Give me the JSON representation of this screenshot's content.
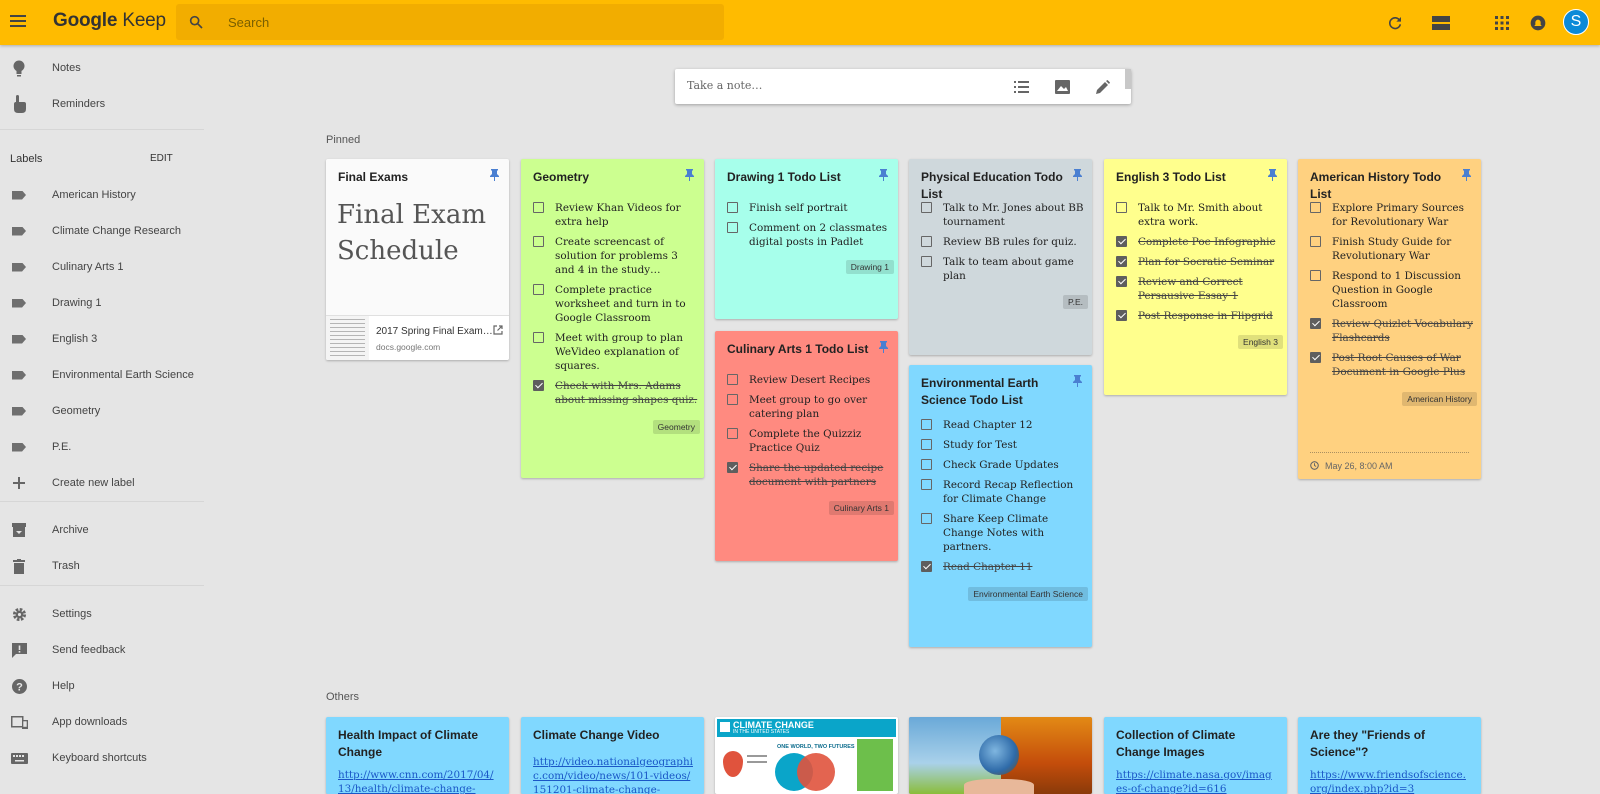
{
  "header": {
    "logo_google": "Google",
    "logo_keep": "Keep",
    "search_placeholder": "Search",
    "avatar_initial": "S"
  },
  "sidebar": {
    "notes": "Notes",
    "reminders": "Reminders",
    "labels_heading": "Labels",
    "labels_edit": "EDIT",
    "labels": [
      "American History",
      "Climate Change Research",
      "Culinary Arts 1",
      "Drawing 1",
      "English 3",
      "Environmental Earth Science",
      "Geometry",
      "P.E."
    ],
    "create_label": "Create new label",
    "archive": "Archive",
    "trash": "Trash",
    "settings": "Settings",
    "send_feedback": "Send feedback",
    "help": "Help",
    "app_downloads": "App downloads",
    "keyboard_shortcuts": "Keyboard shortcuts"
  },
  "take_note": {
    "placeholder": "Take a note…"
  },
  "sections": {
    "pinned": "Pinned",
    "others": "Others"
  },
  "colors": {
    "header": "#ffbb00",
    "white": "#fafafa",
    "green": "#ccff90",
    "teal": "#a7ffeb",
    "gray": "#cfd8dc",
    "yellow": "#ffff8d",
    "orange": "#ffd180",
    "red": "#ff8a80",
    "blue": "#80d8ff"
  },
  "notes": {
    "final_exams": {
      "title": "Final Exams",
      "big_text_line1": "Final Exam",
      "big_text_line2": "Schedule",
      "doc_name": "2017 Spring Final Exam…",
      "doc_domain": "docs.google.com"
    },
    "geometry": {
      "title": "Geometry",
      "items": [
        {
          "text": "Review Khan Videos for extra help",
          "checked": false
        },
        {
          "text": "Create screencast of solution for problems 3 and 4 in the study…",
          "checked": false
        },
        {
          "text": "Complete practice worksheet and turn in to Google Classroom",
          "checked": false
        },
        {
          "text": "Meet with group to plan WeVideo explanation of squares.",
          "checked": false
        },
        {
          "text": "Check with Mrs. Adams about missing shapes quiz.",
          "checked": true
        }
      ],
      "label": "Geometry"
    },
    "drawing": {
      "title": "Drawing 1 Todo List",
      "items": [
        {
          "text": "Finish self portrait",
          "checked": false
        },
        {
          "text": "Comment on 2 classmates digital posts in Padlet",
          "checked": false
        }
      ],
      "label": "Drawing 1"
    },
    "culinary": {
      "title": "Culinary Arts 1 Todo List",
      "items": [
        {
          "text": "Review Desert Recipes",
          "checked": false
        },
        {
          "text": "Meet group to go over catering plan",
          "checked": false
        },
        {
          "text": "Complete the Quizziz Practice Quiz",
          "checked": false
        },
        {
          "text": "Share the updated recipe document with partners",
          "checked": true
        }
      ],
      "label": "Culinary Arts 1"
    },
    "pe": {
      "title": "Physical Education Todo List",
      "items": [
        {
          "text": "Talk to Mr. Jones about BB tournament",
          "checked": false
        },
        {
          "text": "Review BB rules for quiz.",
          "checked": false
        },
        {
          "text": "Talk to team about game plan",
          "checked": false
        }
      ],
      "label": "P.E."
    },
    "earth": {
      "title": "Environmental Earth Science Todo List",
      "items": [
        {
          "text": "Read Chapter 12",
          "checked": false
        },
        {
          "text": "Study for Test",
          "checked": false
        },
        {
          "text": "Check Grade Updates",
          "checked": false
        },
        {
          "text": "Record Recap Reflection for Climate Change",
          "checked": false
        },
        {
          "text": "Share Keep Climate Change Notes with partners.",
          "checked": false
        },
        {
          "text": "Read Chapter 11",
          "checked": true
        }
      ],
      "label": "Environmental Earth Science"
    },
    "english": {
      "title": "English 3 Todo List",
      "items": [
        {
          "text": "Talk to Mr. Smith about extra work.",
          "checked": false
        },
        {
          "text": "Complete Poe Infographic",
          "checked": true
        },
        {
          "text": "Plan for Socratic Seminar",
          "checked": true
        },
        {
          "text": "Review and Correct Persausive Essay 1",
          "checked": true
        },
        {
          "text": "Post Response in Flipgrid",
          "checked": true
        }
      ],
      "label": "English 3"
    },
    "history": {
      "title": "American History Todo List",
      "items": [
        {
          "text": "Explore Primary Sources for Revolutionary War",
          "checked": false
        },
        {
          "text": "Finish Study Guide for Revolutionary War",
          "checked": false
        },
        {
          "text": "Respond to 1 Discussion Question in Google Classroom",
          "checked": false
        },
        {
          "text": "Review Quizlet Vocabulary Flashcards",
          "checked": true
        },
        {
          "text": "Post Root Causes of War Document in Google Plus",
          "checked": true
        }
      ],
      "label": "American History",
      "reminder": "May 26, 8:00 AM"
    }
  },
  "others": {
    "health": {
      "title": "Health Impact of Climate Change",
      "link": "http://www.cnn.com/2017/04/13/health/climate-change-"
    },
    "video": {
      "title": "Climate Change Video",
      "link": "http://video.nationalgeographic.com/video/news/101-videos/151201-climate-change-"
    },
    "infographic": {
      "title": "CLIMATE CHANGE",
      "subtitle": "IN THE UNITED STATES",
      "caption": "ONE WORLD, TWO FUTURES"
    },
    "images": {
      "title": "Collection of Climate Change Images",
      "link": "https://climate.nasa.gov/images-of-change?id=616"
    },
    "friends": {
      "title": "Are they \"Friends of Science\"?",
      "link": "https://www.friendsofscience.org/index.php?id=3"
    }
  }
}
